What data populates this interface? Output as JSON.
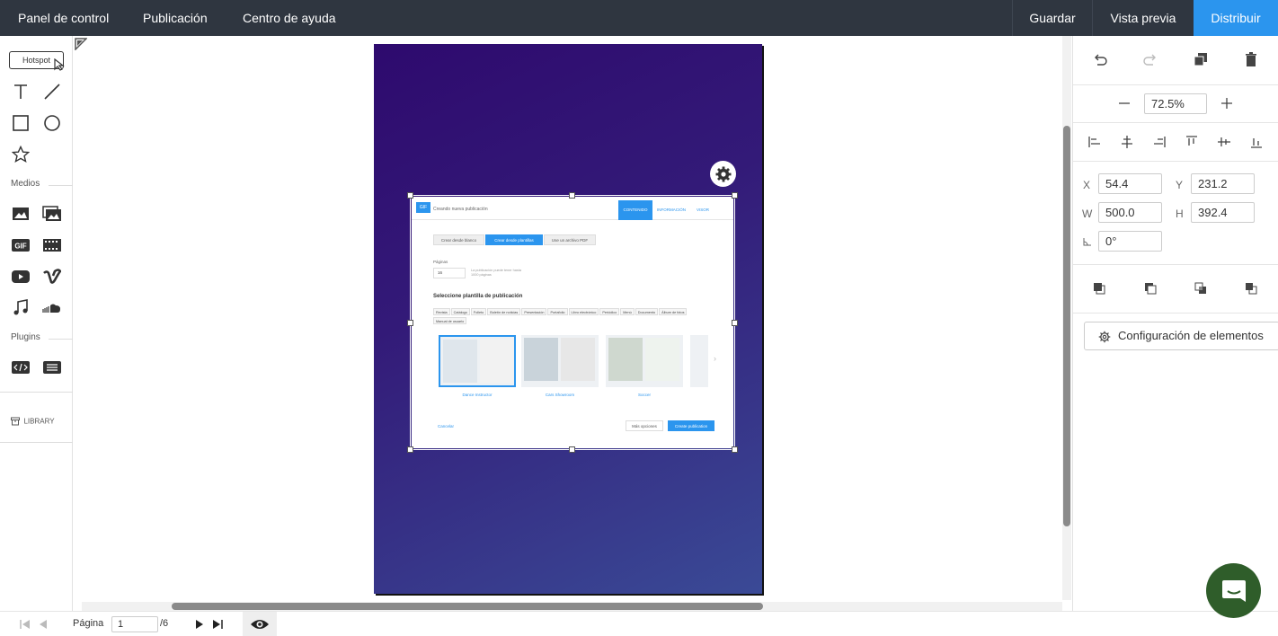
{
  "topbar": {
    "nav": [
      "Panel de control",
      "Publicación",
      "Centro de ayuda"
    ],
    "save": "Guardar",
    "preview": "Vista previa",
    "distribute": "Distribuir",
    "accent": "#2b95ee"
  },
  "tools": {
    "hotspot": "Hotspot",
    "media_label": "Medios",
    "plugins_label": "Plugins",
    "library": "LIBRARY"
  },
  "embedded": {
    "logo": "GIF",
    "title": "Creando nueva publicación",
    "tabs": [
      "CONTENIDO",
      "INFORMACIÓN",
      "VISOR"
    ],
    "mode_buttons": [
      "Crear desde blanco",
      "Crear desde plantillas",
      "Use un archivo PDF"
    ],
    "pages_label": "Páginas",
    "pages_value": "16",
    "pages_hint": "La publicación puede tener hasta 1000 páginas",
    "section_title": "Seleccione plantilla de publicación",
    "categories": [
      "Revista",
      "Catálogo",
      "Folleto",
      "Boletín de noticias",
      "Presentación",
      "Portafolio",
      "Libro electrónico",
      "Periódico",
      "Menú",
      "Documento",
      "Álbum de fotos",
      "Manual de usuario"
    ],
    "templates": [
      "Dance Instructor",
      "Cars Showroom",
      "Soccer"
    ],
    "cancel": "Cancelar",
    "more_options": "Más opciones",
    "create": "Create publication"
  },
  "rightpanel": {
    "zoom": "72.5%",
    "x_label": "X",
    "x": "54.4",
    "y_label": "Y",
    "y": "231.2",
    "w_label": "W",
    "w": "500.0",
    "h_label": "H",
    "h": "392.4",
    "rotation": "0°",
    "settings": "Configuración de elementos"
  },
  "bottombar": {
    "page_label": "Página",
    "page_value": "1",
    "page_total": "/6"
  }
}
